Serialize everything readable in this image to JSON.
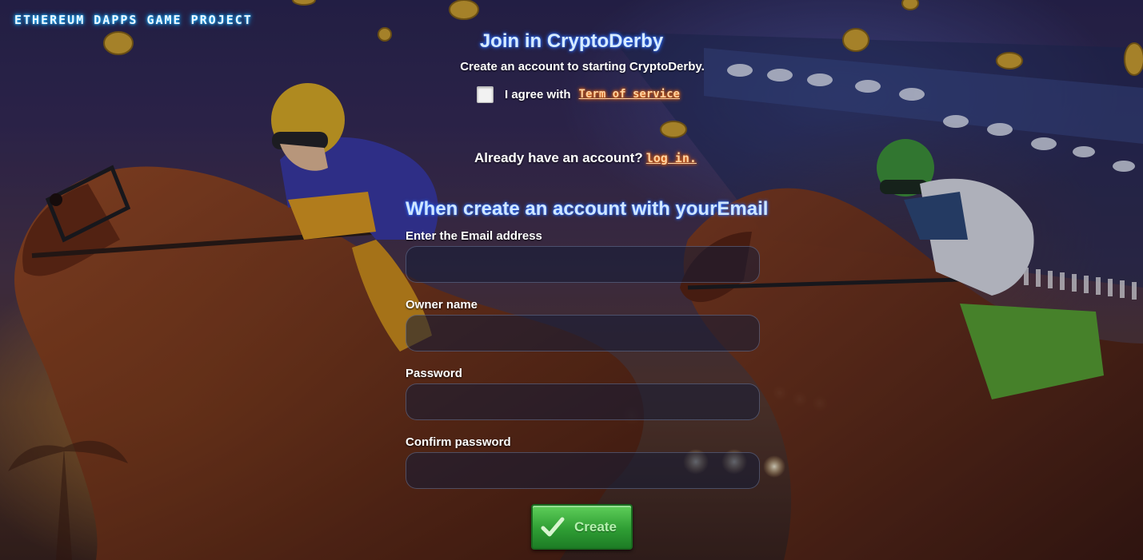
{
  "brand": {
    "title": "ETHEREUM DAPPS GAME PROJECT"
  },
  "signup": {
    "title": "Join in CryptoDerby",
    "subtitle": "Create an account to starting CryptoDerby.",
    "agree_label": "I agree with",
    "terms_link": "Term of service",
    "agree_checked": false,
    "already_text": "Already have an account?",
    "login_link": "log in.",
    "form_heading": "When create an account with yourEmail"
  },
  "form": {
    "fields": [
      {
        "label": "Enter the Email address",
        "value": "",
        "type": "email"
      },
      {
        "label": "Owner name",
        "value": "",
        "type": "text"
      },
      {
        "label": "Password",
        "value": "",
        "type": "password"
      },
      {
        "label": "Confirm password",
        "value": "",
        "type": "password"
      }
    ],
    "submit_label": "Create"
  },
  "colors": {
    "title_glow": "#2a6cff",
    "link_glow": "#ff6a00",
    "brand_glow": "#0a8fe6",
    "button_green": "#2f9e34"
  },
  "icons": {
    "checkmark": "check-icon"
  }
}
